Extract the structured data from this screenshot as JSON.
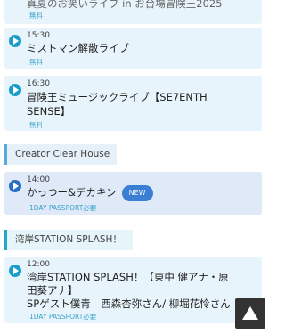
{
  "events": [
    {
      "title": "真夏のお笑いライブ in お台場冒険王2025",
      "price": "無料"
    },
    {
      "time": "15:30",
      "title": "ミストマン解散ライブ",
      "price": "無料"
    },
    {
      "time": "16:30",
      "title_line1": "冒険王ミュージックライブ【SE7ENTH",
      "title_line2": "SENSE】",
      "price": "無料"
    }
  ],
  "section_creator": "Creator Clear House",
  "creator_event": {
    "time": "14:00",
    "title": "かっつー&デカキン",
    "badge": "NEW",
    "pass": "1DAY PASSPORT必要"
  },
  "section_station": "湾岸STATION SPLASH！",
  "station_event": {
    "time": "12:00",
    "title_line1": "湾岸STATION SPLASH！【東中 健アナ・原",
    "title_line2": "田葵アナ】",
    "title_line3": "SPゲスト僕青　西森杏弥さん/ 柳堀花怜さん",
    "pass": "1DAY PASSPORT必要"
  },
  "icons": {
    "play": "play-icon",
    "scroll_top": "arrow-up-icon"
  }
}
